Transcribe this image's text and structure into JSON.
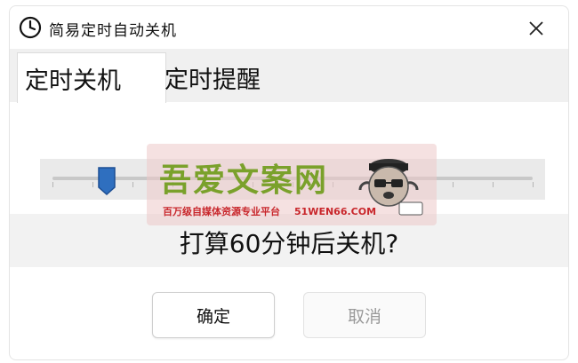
{
  "window": {
    "title": "简易定时自动关机",
    "close_label": "✕"
  },
  "tabs": [
    {
      "label": "定时关机",
      "active": true
    },
    {
      "label": "定时提醒",
      "active": false
    }
  ],
  "slider": {
    "value_minutes": 60
  },
  "question": "打算60分钟后关机?",
  "buttons": {
    "ok": "确定",
    "cancel": "取消"
  },
  "watermark": {
    "title": "吾爱文案网",
    "subtitle": "百万级自媒体资源专业平台",
    "url": "51WEN66.COM"
  },
  "colors": {
    "slider_thumb": "#2f6fbf",
    "watermark_green": "#7aa12b",
    "watermark_red": "#c8262b"
  }
}
